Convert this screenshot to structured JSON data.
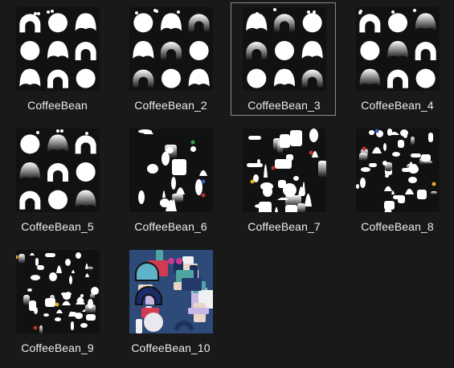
{
  "files": [
    {
      "name": "CoffeeBean",
      "variant": "bw-blobs",
      "selected": false
    },
    {
      "name": "CoffeeBean_2",
      "variant": "bw-gradient",
      "selected": false
    },
    {
      "name": "CoffeeBean_3",
      "variant": "bw-arches",
      "selected": true
    },
    {
      "name": "CoffeeBean_4",
      "variant": "bw-shapes",
      "selected": false
    },
    {
      "name": "CoffeeBean_5",
      "variant": "bw-sparse",
      "selected": false
    },
    {
      "name": "CoffeeBean_6",
      "variant": "bw-mixed",
      "selected": false
    },
    {
      "name": "CoffeeBean_7",
      "variant": "bw-dense",
      "selected": false
    },
    {
      "name": "CoffeeBean_8",
      "variant": "bw-atlas",
      "selected": false
    },
    {
      "name": "CoffeeBean_9",
      "variant": "bw-scatter",
      "selected": false
    },
    {
      "name": "CoffeeBean_10",
      "variant": "color-atlas",
      "selected": false
    }
  ],
  "colors": {
    "background": "#191919",
    "label": "#ededed",
    "selection_border": "#8a8a8a"
  }
}
